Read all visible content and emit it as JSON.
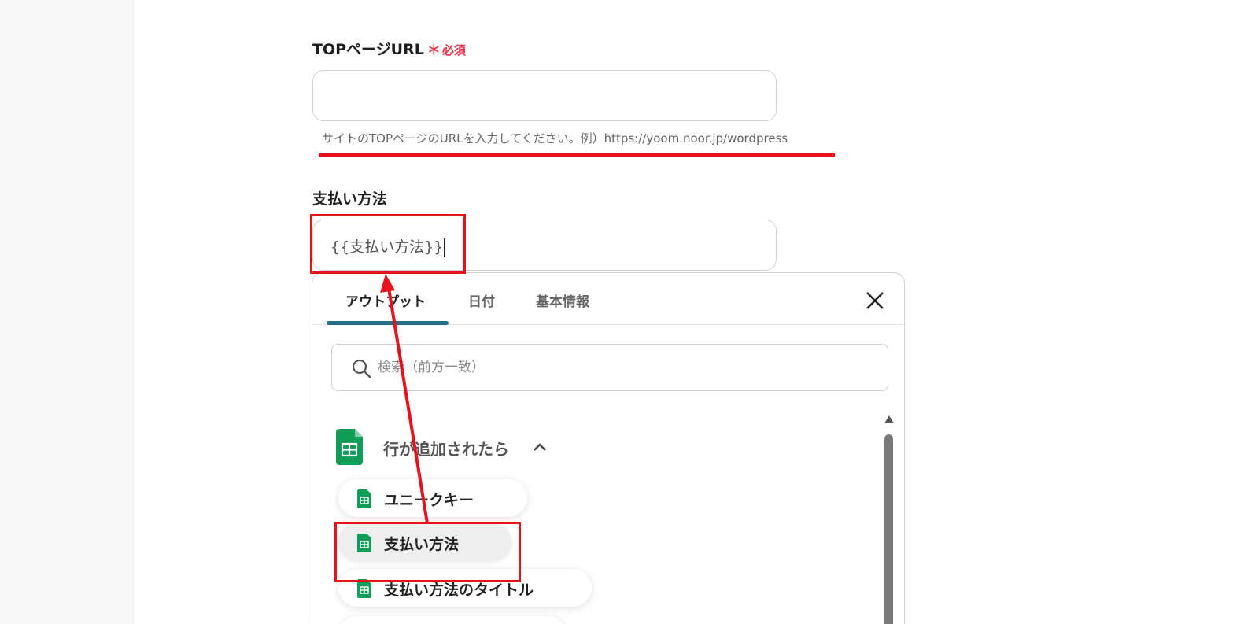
{
  "url_field": {
    "label": "TOPページURL",
    "required_mark": "＊",
    "required_text": "必須",
    "value": "",
    "hint": "サイトのTOPページのURLを入力してください。例）https://yoom.noor.jp/wordpress"
  },
  "payment_field": {
    "label": "支払い方法",
    "value": "{{支払い方法}}"
  },
  "popup": {
    "tabs": [
      {
        "label": "アウトプット",
        "active": true
      },
      {
        "label": "日付",
        "active": false
      },
      {
        "label": "基本情報",
        "active": false
      }
    ],
    "close_icon": "close-icon",
    "search_placeholder": "検索（前方一致）",
    "group": {
      "title": "行が追加されたら",
      "icon": "google-sheets-icon",
      "expanded": true,
      "items": [
        {
          "label": "ユニークキー",
          "selected": false
        },
        {
          "label": "支払い方法",
          "selected": true
        },
        {
          "label": "支払い方法のタイトル",
          "selected": false
        }
      ]
    }
  },
  "colors": {
    "accent": "#1f6f8b",
    "required": "#e8394b",
    "annotation": "#e8121c",
    "sheets_green": "#0f9d58"
  }
}
